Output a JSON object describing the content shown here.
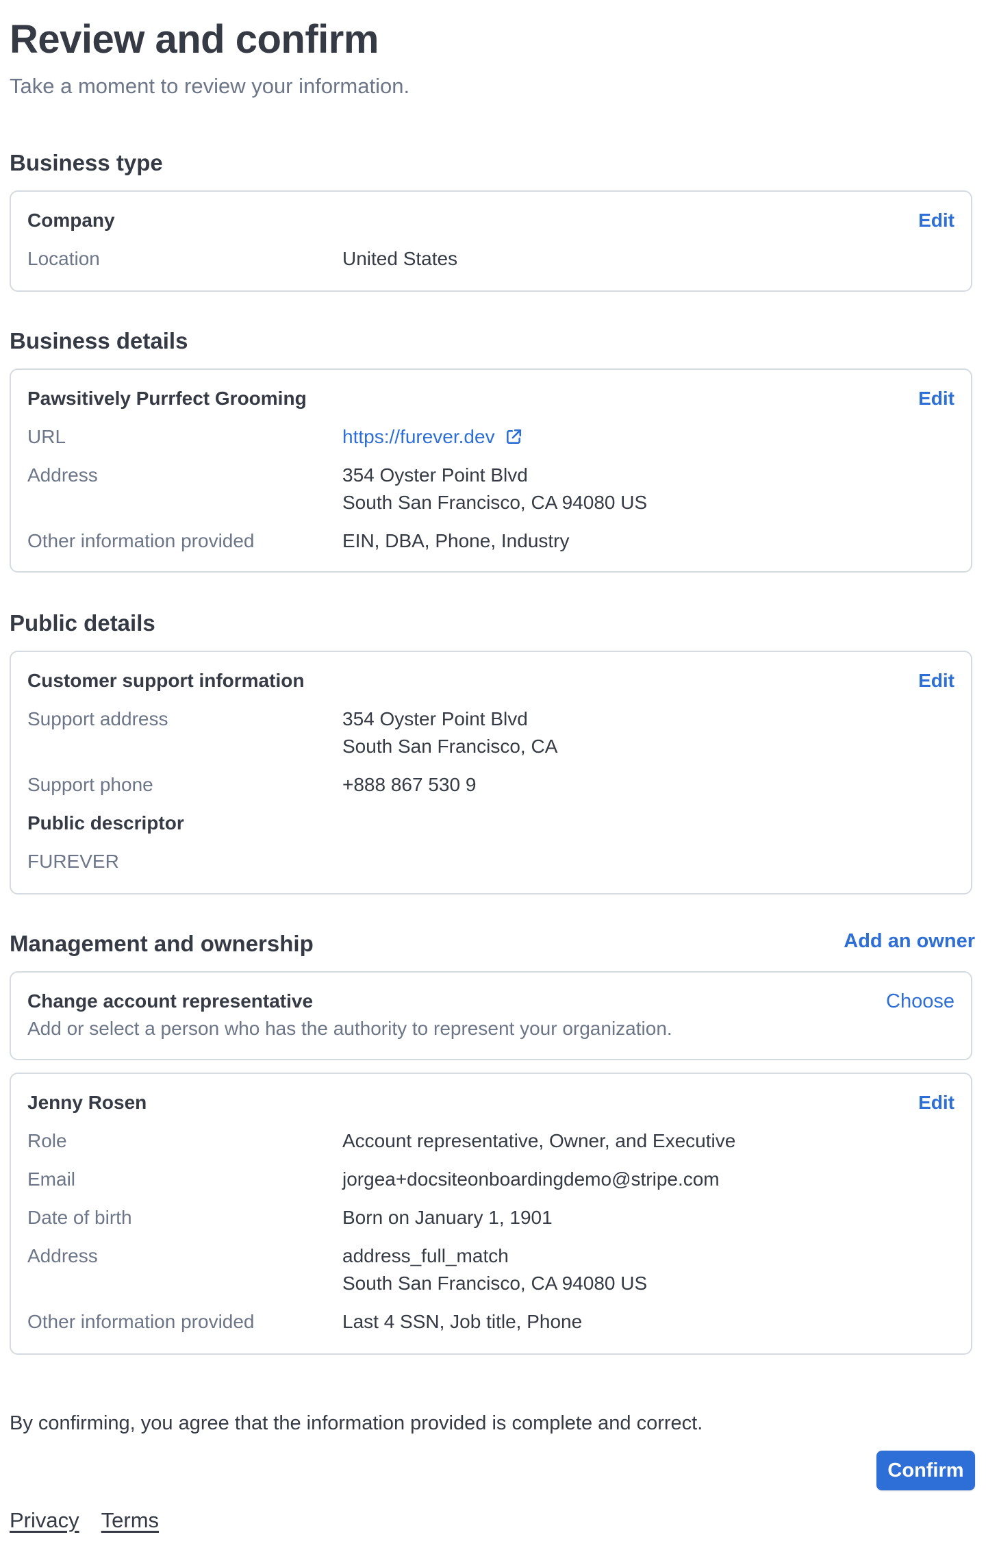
{
  "header": {
    "title": "Review and confirm",
    "subtitle": "Take a moment to review your information."
  },
  "business_type": {
    "heading": "Business type",
    "card_title": "Company",
    "edit_label": "Edit",
    "rows": [
      {
        "label": "Location",
        "value": "United States"
      }
    ]
  },
  "business_details": {
    "heading": "Business details",
    "card_title": "Pawsitively Purrfect Grooming",
    "edit_label": "Edit",
    "url_label": "URL",
    "url_value": "https://furever.dev",
    "url_icon": "external-link-icon",
    "address_label": "Address",
    "address_lines": [
      "354 Oyster Point Blvd",
      "South San Francisco, CA 94080 US"
    ],
    "other_label": "Other information provided",
    "other_value": "EIN, DBA, Phone, Industry"
  },
  "public_details": {
    "heading": "Public details",
    "card_title": "Customer support information",
    "edit_label": "Edit",
    "support_address_label": "Support address",
    "support_address_lines": [
      "354 Oyster Point Blvd",
      "South San Francisco, CA"
    ],
    "support_phone_label": "Support phone",
    "support_phone_value": "+888 867 530 9",
    "descriptor_title": "Public descriptor",
    "descriptor_value": "FUREVER"
  },
  "management": {
    "heading": "Management and ownership",
    "add_owner_label": "Add an owner",
    "representative_card": {
      "title": "Change account representative",
      "description": "Add or select a person who has the authority to represent your organization.",
      "choose_label": "Choose"
    },
    "person_card": {
      "name": "Jenny Rosen",
      "edit_label": "Edit",
      "role_label": "Role",
      "role_value": "Account representative, Owner, and Executive",
      "email_label": "Email",
      "email_value": "jorgea+docsiteonboardingdemo@stripe.com",
      "dob_label": "Date of birth",
      "dob_value": "Born on January 1, 1901",
      "address_label": "Address",
      "address_lines": [
        "address_full_match",
        "South San Francisco, CA 94080 US"
      ],
      "other_label": "Other information provided",
      "other_value": "Last 4 SSN, Job title, Phone"
    }
  },
  "consent": {
    "text": "By confirming, you agree that the information provided is complete and correct.",
    "confirm_label": "Confirm"
  },
  "footer": {
    "privacy_label": "Privacy",
    "terms_label": "Terms"
  },
  "colors": {
    "accent": "#2d6fd6",
    "text_primary": "#353a44",
    "text_secondary": "#6c7688",
    "border": "#d5dbe1"
  }
}
